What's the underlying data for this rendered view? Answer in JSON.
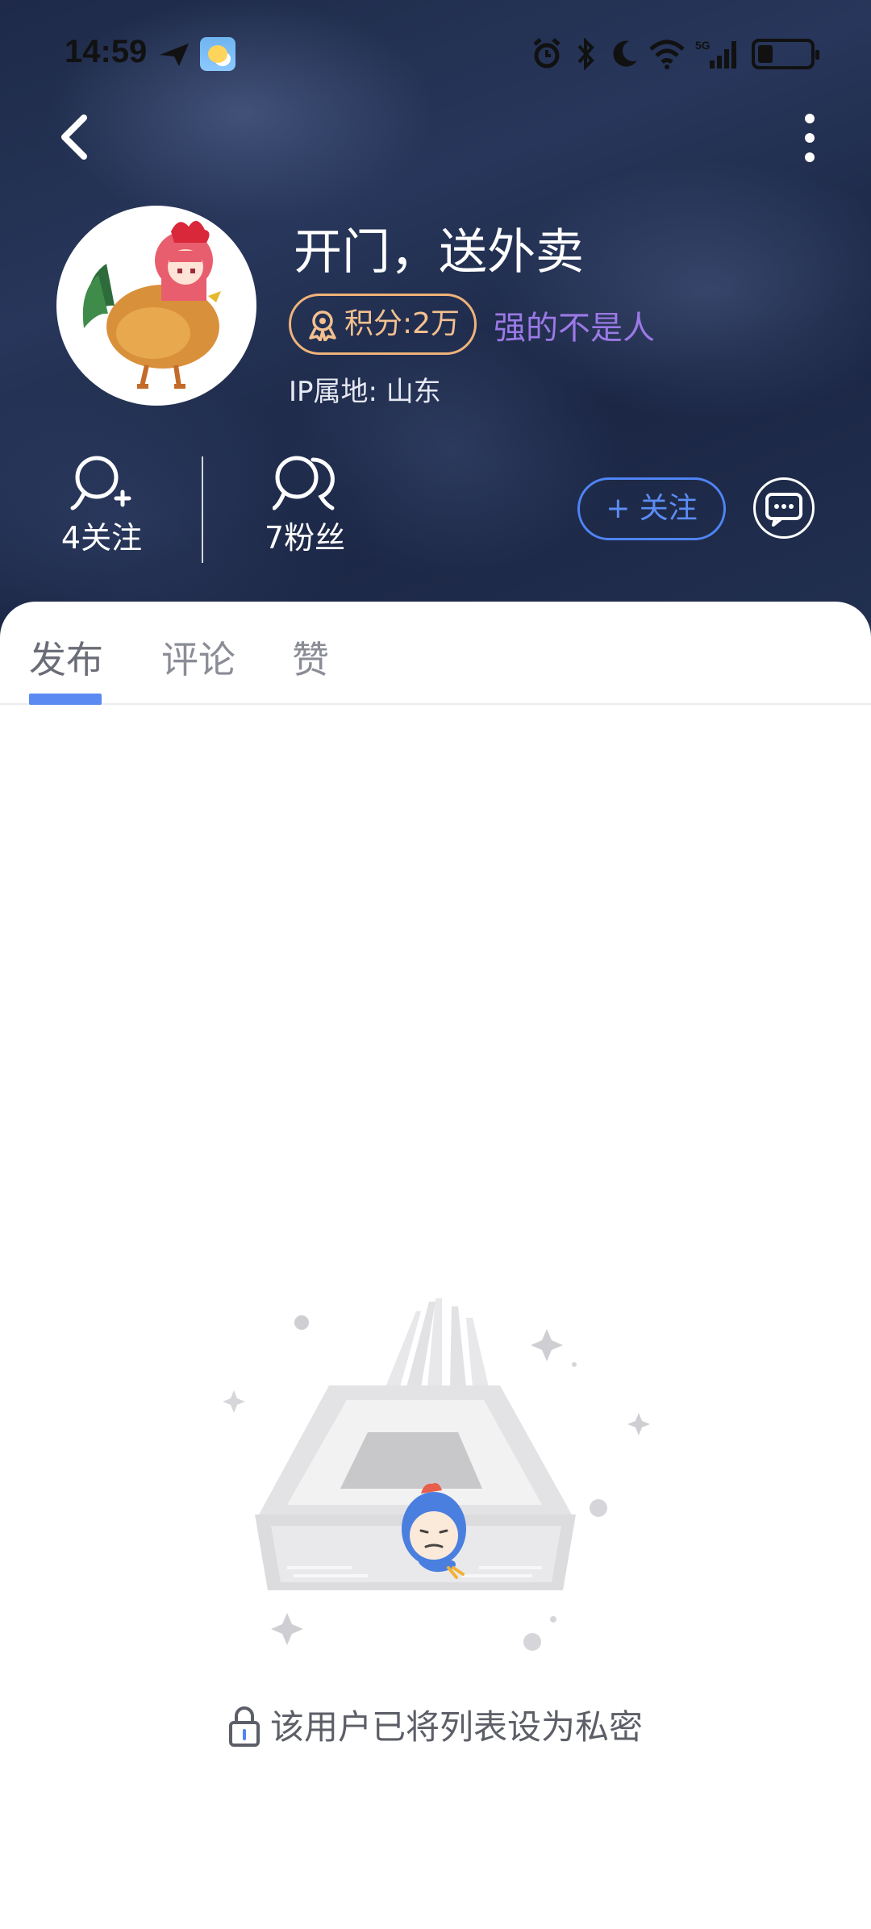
{
  "status_bar": {
    "time": "14:59",
    "network": "5G",
    "icons": [
      "send-icon",
      "weather-icon",
      "alarm-icon",
      "bluetooth-icon",
      "moon-icon",
      "wifi-icon",
      "signal-icon",
      "battery-icon"
    ]
  },
  "nav": {
    "back_icon": "chevron-left-icon",
    "more_icon": "more-vertical-icon"
  },
  "profile": {
    "username": "开门，送外卖",
    "points_label": "积分:2万",
    "title_tag": "强的不是人",
    "ip_location": "IP属地: 山东",
    "following_label": "4关注",
    "fans_label": "7粉丝",
    "follow_button_label": "+ 关注"
  },
  "tabs": [
    {
      "label": "发布",
      "active": true
    },
    {
      "label": "评论",
      "active": false
    },
    {
      "label": "赞",
      "active": false
    }
  ],
  "empty_state": {
    "message": "该用户已将列表设为私密"
  },
  "colors": {
    "accent": "#5b8bf2",
    "points": "#f0b37a",
    "title_tag": "#9b79e6",
    "header_bg": "#1e2a48"
  }
}
